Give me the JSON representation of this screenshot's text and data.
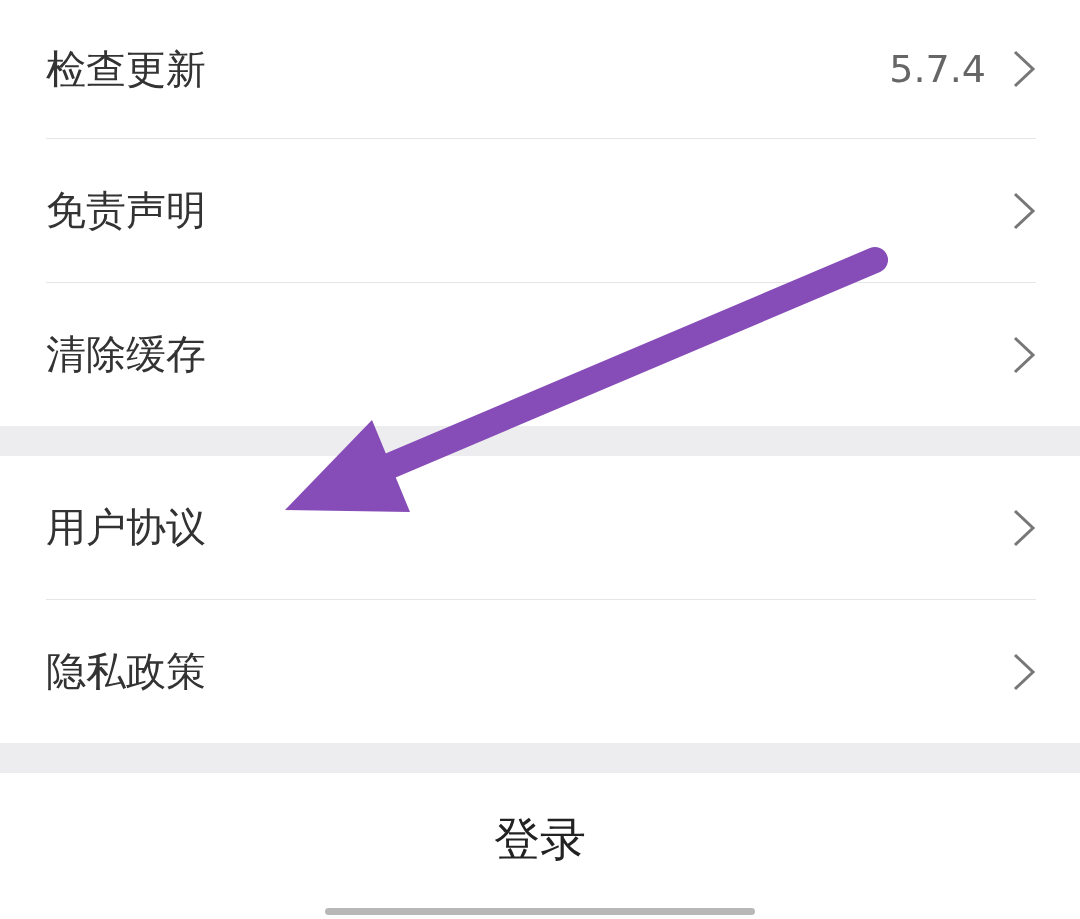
{
  "sections": [
    {
      "items": [
        {
          "label": "检查更新",
          "value": "5.7.4"
        },
        {
          "label": "免责声明"
        },
        {
          "label": "清除缓存"
        }
      ]
    },
    {
      "items": [
        {
          "label": "用户协议"
        },
        {
          "label": "隐私政策"
        }
      ]
    }
  ],
  "login_button": {
    "label": "登录"
  }
}
